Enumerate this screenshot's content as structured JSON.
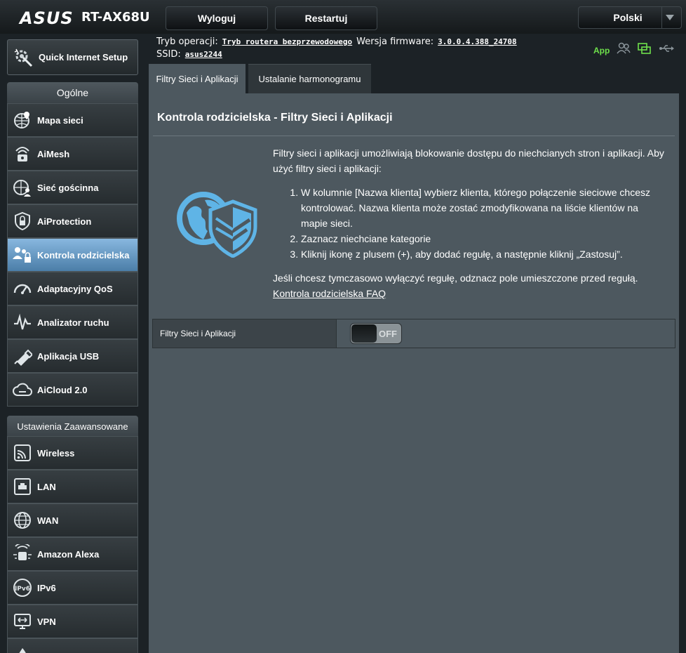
{
  "header": {
    "brand": "ASUS",
    "model": "RT-AX68U",
    "logout_label": "Wyloguj",
    "restart_label": "Restartuj",
    "language": "Polski"
  },
  "status": {
    "mode_label": "Tryb operacji:",
    "mode_value": "Tryb routera bezprzewodowego",
    "fw_label": "Wersja firmware:",
    "fw_value": "3.0.0.4.388_24708",
    "ssid_label": "SSID:",
    "ssid_value": "asus2244",
    "app_label": "App"
  },
  "sidebar": {
    "qis_label": "Quick Internet Setup",
    "general_header": "Ogólne",
    "general_items": [
      {
        "label": "Mapa sieci"
      },
      {
        "label": "AiMesh"
      },
      {
        "label": "Sieć gościnna"
      },
      {
        "label": "AiProtection"
      },
      {
        "label": "Kontrola rodzicielska"
      },
      {
        "label": "Adaptacyjny QoS"
      },
      {
        "label": "Analizator ruchu"
      },
      {
        "label": "Aplikacja USB"
      },
      {
        "label": "AiCloud 2.0"
      }
    ],
    "advanced_header": "Ustawienia Zaawansowane",
    "advanced_items": [
      {
        "label": "Wireless"
      },
      {
        "label": "LAN"
      },
      {
        "label": "WAN"
      },
      {
        "label": "Amazon Alexa"
      },
      {
        "label": "IPv6"
      },
      {
        "label": "VPN"
      }
    ]
  },
  "tabs": [
    {
      "label": "Filtry Sieci i Aplikacji"
    },
    {
      "label": "Ustalanie harmonogramu"
    }
  ],
  "main": {
    "title": "Kontrola rodzicielska - Filtry Sieci i Aplikacji",
    "intro": "Filtry sieci i aplikacji umożliwiają blokowanie dostępu do niechcianych stron i aplikacji. Aby użyć filtry sieci i aplikacji:",
    "steps": [
      "W kolumnie [Nazwa klienta] wybierz klienta, którego połączenie sieciowe chcesz kontrolować. Nazwa klienta może zostać zmodyfikowana na liście klientów na mapie sieci.",
      "Zaznacz niechciane kategorie",
      "Kliknij ikonę z plusem (+), aby dodać regułę, a następnie kliknij „Zastosuj”."
    ],
    "note": "Jeśli chcesz tymczasowo wyłączyć regułę, odznacz pole umieszczone przed regułą.",
    "faq_link": "Kontrola rodzicielska FAQ",
    "setting_label": "Filtry Sieci i Aplikacji",
    "toggle_state": "OFF"
  },
  "colors": {
    "accent": "#6ee04b",
    "active_nav": "#6fa2cf",
    "panel": "#4d585f"
  }
}
